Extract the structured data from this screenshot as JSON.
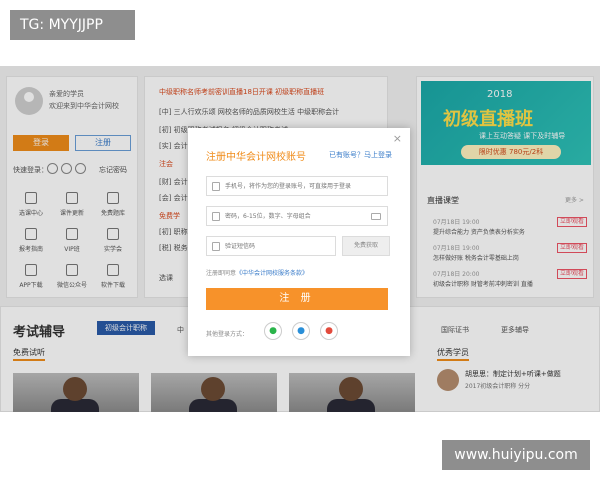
{
  "watermarks": {
    "top": "TG: MYYJJPP",
    "bottom": "www.huiyipu.com"
  },
  "left_panel": {
    "greeting_line1": "亲爱的学员",
    "greeting_line2": "欢迎来到中华会计网校",
    "login_label": "登录",
    "register_label": "注册",
    "quick_login_label": "快速登录：",
    "help_label": "忘记密码",
    "grid": [
      {
        "label": "选课中心",
        "icon": "monitor-icon"
      },
      {
        "label": "课件更新",
        "icon": "document-icon"
      },
      {
        "label": "免费题库",
        "icon": "list-icon"
      },
      {
        "label": "报考指南",
        "icon": "chat-icon"
      },
      {
        "label": "VIP班",
        "icon": "shield-icon"
      },
      {
        "label": "实学会",
        "icon": "book-icon"
      },
      {
        "label": "APP下载",
        "icon": "phone-icon"
      },
      {
        "label": "微信公众号",
        "icon": "grid-icon"
      },
      {
        "label": "软件下载",
        "icon": "download-icon"
      }
    ]
  },
  "news": [
    {
      "text": "中级职称名师考前密训直播18日开课   初级职称直播班",
      "red": true
    },
    {
      "text": "[中]  三人行欢乐颂 网校名师的品质网校生活   中级职称会计",
      "red": false
    },
    {
      "text": "[初]  初级职称考试报名    初级会计职称考试",
      "red": false
    },
    {
      "text": "[实]  会计实务  中级会计职称",
      "red": false
    },
    {
      "text": "注会",
      "red": true
    },
    {
      "text": "[财]  会计",
      "red": false
    },
    {
      "text": "[会]  会计",
      "red": false
    },
    {
      "text": "免费学",
      "red": true
    },
    {
      "text": "[初]  职称",
      "red": false
    },
    {
      "text": "[税]  税务",
      "red": false
    },
    {
      "text": "选课",
      "red": false
    }
  ],
  "banner": {
    "year": "2018",
    "title": "初级直播班",
    "subtitle": "课上互动答疑  课下及时辅导",
    "price": "限时优惠  780元/2科"
  },
  "live": {
    "title": "直播课堂",
    "more": "更多 >",
    "items": [
      {
        "time": "07月18日  19:00",
        "text": "提升综合能力 资产负债表分析实务",
        "tag": "立即观看"
      },
      {
        "time": "07月18日  19:00",
        "text": "怎样做好账 税务会计零基础上岗",
        "tag": "立即观看"
      },
      {
        "time": "07月18日  20:00",
        "text": "初级会计职称 财管考前冲刺密训 直播",
        "tag": "立即观看"
      }
    ]
  },
  "exam": {
    "title": "考试辅导",
    "active_tab": "初级会计职称",
    "links": [
      "中",
      "国际证书",
      "更多辅导"
    ],
    "free_try": "免费试听",
    "excellent": "优秀学员",
    "student_name": "胡思思：制定计划+听课+做题",
    "student_desc": "2017初级会计职称    分分"
  },
  "modal": {
    "close": "×",
    "title": "注册中华会计网校账号",
    "have_account": "已有账号？马上登录",
    "phone_placeholder": "手机号，将作为您的登录账号，可直接用于登录",
    "password_placeholder": "密码，6-15位，数字、字母组合",
    "code_placeholder": "验证短信码",
    "get_code": "免费获取",
    "agree_prefix": "注册即同意",
    "agree_link": "《中华会计网校服务条款》",
    "submit": "注 册",
    "other_login": "其他登录方式：",
    "social_icons": [
      "wechat-icon",
      "qq-icon",
      "weibo-icon"
    ]
  },
  "colors": {
    "accent": "#f7922a",
    "link": "#3a7cc9",
    "banner": "#1aa8a8"
  }
}
